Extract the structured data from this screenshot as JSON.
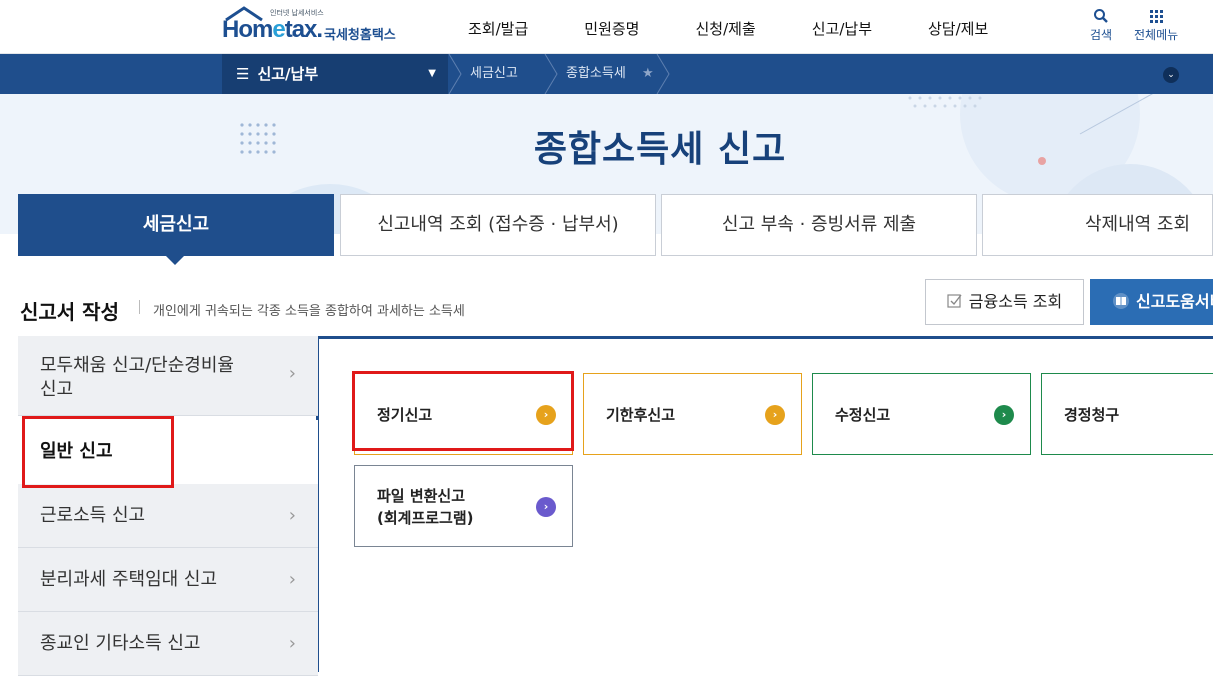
{
  "header": {
    "logo_small": "인터넷 납세서비스",
    "logo_main_left": "Hom",
    "logo_main_e": "e",
    "logo_main_right": "tax.",
    "logo_kr": "국세청홈택스",
    "gnb": [
      "조회/발급",
      "민원증명",
      "신청/제출",
      "신고/납부",
      "상담/제보"
    ],
    "search_label": "검색",
    "allmenu_label": "전체메뉴"
  },
  "location": {
    "menu_label": "신고/납부",
    "crumbs": [
      "세금신고",
      "종합소득세"
    ]
  },
  "hero": {
    "title": "종합소득세 신고"
  },
  "tabs": [
    "세금신고",
    "신고내역 조회 (접수증 · 납부서)",
    "신고 부속 · 증빙서류 제출",
    "삭제내역 조회"
  ],
  "section": {
    "title": "신고서 작성",
    "desc": "개인에게 귀속되는 각종 소득을 종합하여 과세하는 소득세",
    "btn_financial": "금융소득 조회",
    "btn_help": "신고도움서비스"
  },
  "lnb": [
    {
      "line1": "모두채움 신고/단순경비율",
      "line2": "신고"
    },
    {
      "line1": "일반 신고"
    },
    {
      "line1": "근로소득 신고"
    },
    {
      "line1": "분리과세 주택임대 신고"
    },
    {
      "line1": "종교인 기타소득 신고"
    }
  ],
  "cards": [
    {
      "line1": "정기신고",
      "line2": ""
    },
    {
      "line1": "기한후신고",
      "line2": ""
    },
    {
      "line1": "수정신고",
      "line2": ""
    },
    {
      "line1": "경정청구",
      "line2": ""
    },
    {
      "line1": "파일 변환신고",
      "line2": "(회계프로그램)"
    }
  ],
  "colors": {
    "navy": "#1f4e8c",
    "card_orange": "#e6a21c",
    "card_green": "#1e8a4c",
    "card_gray": "#7a8593",
    "card_purple": "#6a5acd",
    "highlight": "#e01919"
  }
}
